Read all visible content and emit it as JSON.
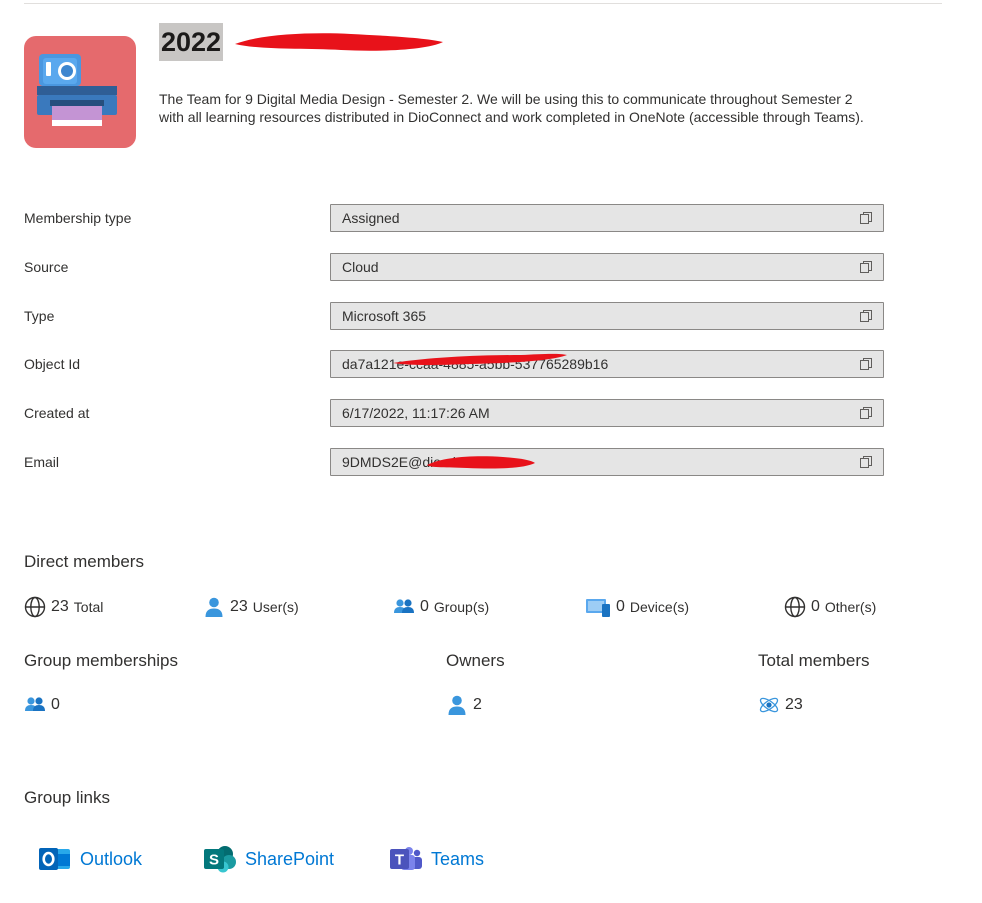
{
  "group": {
    "title": "2022",
    "description": "The Team for 9 Digital Media Design - Semester 2. We will be using this to communicate throughout Semester 2 with all learning resources distributed in DioConnect and work completed in OneNote (accessible through Teams).",
    "logo_icon": "instant-camera-icon",
    "logo_color": "#e56a6d"
  },
  "properties": [
    {
      "label": "Membership type",
      "value": "Assigned"
    },
    {
      "label": "Source",
      "value": "Cloud"
    },
    {
      "label": "Type",
      "value": "Microsoft 365"
    },
    {
      "label": "Object Id",
      "value": "da7a121e-ccaa-4885-a5bb-537765289b16"
    },
    {
      "label": "Created at",
      "value": "6/17/2022, 11:17:26 AM"
    },
    {
      "label": "Email",
      "value": "9DMDS2E@dio                ol.nz"
    }
  ],
  "direct_members": {
    "title": "Direct members",
    "total": {
      "count": "23",
      "label": "Total"
    },
    "users": {
      "count": "23",
      "label": "User(s)"
    },
    "groups": {
      "count": "0",
      "label": "Group(s)"
    },
    "devices": {
      "count": "0",
      "label": "Device(s)"
    },
    "others": {
      "count": "0",
      "label": "Other(s)"
    }
  },
  "summary": {
    "group_memberships": {
      "title": "Group memberships",
      "count": "0"
    },
    "owners": {
      "title": "Owners",
      "count": "2"
    },
    "total_members": {
      "title": "Total members",
      "count": "23"
    }
  },
  "group_links": {
    "title": "Group links",
    "outlook": "Outlook",
    "sharepoint": "SharePoint",
    "teams": "Teams"
  },
  "colors": {
    "accent": "#0078d4",
    "redaction": "#e8121a",
    "field_bg": "#e5e5e5"
  }
}
